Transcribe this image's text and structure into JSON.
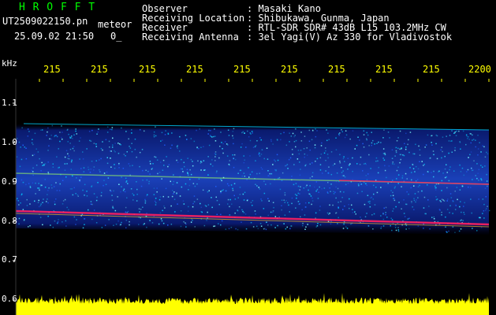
{
  "header": {
    "logo": "H R O F F T",
    "filename": "UT2509022150.pn",
    "file_type": "meteor",
    "datetime": "25.09.02 21:50",
    "frame_index": "0_"
  },
  "station": {
    "observer_label": "Observer",
    "observer_value": ": Masaki Kano",
    "location_label": "Receiving Location",
    "location_value": ": Shibukawa, Gunma, Japan",
    "receiver_label": "Receiver",
    "receiver_value": ": RTL-SDR SDR# 43dB L15 103.2MHz CW",
    "antenna_label": "Receiving Antenna",
    "antenna_value": ": 3el Yagi(V) Az 330 for Vladivostok"
  },
  "axis": {
    "unit_label": "kHz",
    "time_ticks": [
      "215",
      "215",
      "215",
      "215",
      "215",
      "215",
      "215",
      "215",
      "215",
      "2200"
    ],
    "freq_ticks": [
      "1.1",
      "1.0",
      "0.9",
      "0.8",
      "0.7",
      "0.6"
    ]
  },
  "colors": {
    "logo": "#00ff00",
    "text": "#ffffff",
    "axis_ticks": "#ffff00",
    "spectrum_dark": "#0a1a6e",
    "spectrum_bright": "#00d0ff",
    "signal_line": "#ff2060",
    "level_bar": "#ffff00"
  }
}
